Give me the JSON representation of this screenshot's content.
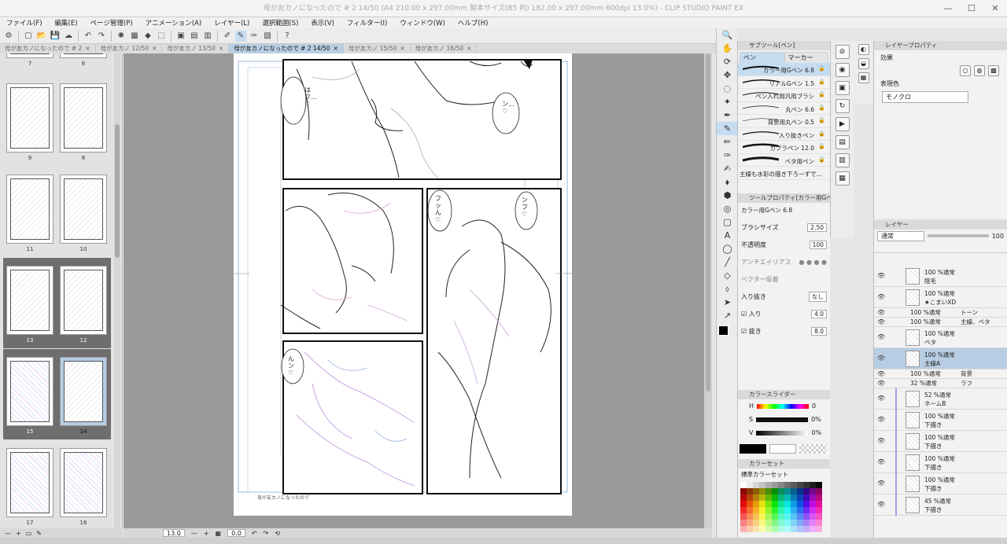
{
  "window": {
    "title": "母が友カノになったので # 2 14/50 (A4 210.00 x 297.00mm 製本サイズ(B5 判) 182.00 x 297.00mm 600dpi 13.0%) - CLIP STUDIO PAINT EX",
    "controls": [
      "—",
      "☐",
      "✕"
    ]
  },
  "menu": [
    "ファイル(F)",
    "編集(E)",
    "ページ管理(P)",
    "アニメーション(A)",
    "レイヤー(L)",
    "選択範囲(S)",
    "表示(V)",
    "フィルター(I)",
    "ウィンドウ(W)",
    "ヘルプ(H)"
  ],
  "toolbar": {
    "icons": [
      "⚙",
      "▢",
      "📂",
      "💾",
      "☁",
      "↶",
      "↷",
      "✺",
      "▦",
      "◆",
      "⬚",
      "▣",
      "▤",
      "▥",
      "✐",
      "✎",
      "✑",
      "▧",
      "?"
    ]
  },
  "doc_tabs": [
    {
      "label": "母が友カノになったので # 2",
      "close": "×",
      "active": false
    },
    {
      "label": "母が友カノ 12/50",
      "close": "×",
      "active": false
    },
    {
      "label": "母が友カノ 13/50",
      "close": "×",
      "active": false
    },
    {
      "label": "母が友カノになったので # 2 14/50",
      "close": "×",
      "active": true
    },
    {
      "label": "母が友カノ 15/50",
      "close": "×",
      "active": false
    },
    {
      "label": "母が友カノ 16/50",
      "close": "×",
      "active": false
    }
  ],
  "pages": {
    "spreads": [
      {
        "left": "7",
        "right": "6",
        "selected": false,
        "color": false
      },
      {
        "left": "9",
        "right": "8",
        "selected": false,
        "color": false
      },
      {
        "left": "11",
        "right": "10",
        "selected": false,
        "color": false
      },
      {
        "left": "13",
        "right": "12",
        "selected": true,
        "color": false
      },
      {
        "left": "15",
        "right": "14",
        "selected": true,
        "color": true,
        "highlight_right": true
      },
      {
        "left": "17",
        "right": "16",
        "selected": false,
        "color": true
      }
    ],
    "bottom": [
      "—",
      "+",
      "▭",
      "✎"
    ]
  },
  "canvas": {
    "speech": [
      "はフ…♡",
      "ン…♡",
      "フッん♡",
      "ンフ♡",
      "んン♡"
    ],
    "footer_text": "母が友カノになったので",
    "status": {
      "zoom": "13.0",
      "angle": "0.0",
      "buttons": [
        "—",
        "+",
        "▦",
        "↶",
        "↷",
        "⟲"
      ]
    }
  },
  "tools": [
    "🔍",
    "✋",
    "⟳",
    "✥",
    "◌",
    "✦",
    "✒",
    "✎",
    "✏",
    "✑",
    "✍",
    "⬧",
    "⬢",
    "◎",
    "▢",
    "A",
    "◯",
    "╱",
    "◇",
    "⬨",
    "➤",
    "↗"
  ],
  "subtool": {
    "title": "サブツール[ペン]",
    "tabs": [
      "ペン",
      "マーカー"
    ],
    "brushes": [
      {
        "name": "カラー用Gペン 6.8",
        "active": true
      },
      {
        "name": "リアルGペン 1.5",
        "active": false
      },
      {
        "name": "ペン入れ用汎用ブラシ",
        "active": false
      },
      {
        "name": "丸ペン 6.6",
        "active": false
      },
      {
        "name": "背景用丸ペン 0.5",
        "active": false
      },
      {
        "name": "入り抜きペン",
        "active": false
      },
      {
        "name": "カブラペン 12.0",
        "active": false
      },
      {
        "name": "ベタ用ペン",
        "active": false
      },
      {
        "name": "主線も水彩の描き下ろ一ずで…",
        "active": false
      }
    ],
    "lock_icon": "🔒"
  },
  "toolprop": {
    "title": "ツールプロパティ[カラー用Gペン 6.8]",
    "preset": "カラー用Gペン 6.8",
    "brush_size_label": "ブラシサイズ",
    "brush_size": "2.50",
    "opacity_label": "不透明度",
    "opacity": "100",
    "antialias_label": "アンチエイリアス",
    "vector_label": "ベクター吸着",
    "taper_label": "入り抜き",
    "taper_value": "なし",
    "in_label": "入り",
    "in_value": "4.0",
    "out_label": "抜き",
    "out_value": "8.0"
  },
  "colorslider": {
    "title": "カラースライダー",
    "h": "0",
    "s": "0%",
    "v": "0%",
    "main": "#000000",
    "sub": "#ffffff"
  },
  "colorset": {
    "title": "カラーセット",
    "selected": "標準カラーセット"
  },
  "layerprop": {
    "title": "レイヤープロパティ",
    "effect_label": "効果",
    "expression_label": "表現色",
    "expression_value": "モノクロ"
  },
  "layers": {
    "title": "レイヤー",
    "blend": "通常",
    "opacity": "100",
    "rows": [
      {
        "type": "layer",
        "line1": "100 %通常",
        "line2": "陰毛",
        "active": false
      },
      {
        "type": "layer",
        "line1": "100 %通常",
        "line2": "★こまいXD",
        "active": false
      },
      {
        "type": "folder",
        "line1": "100 %通常",
        "line2": "トーン",
        "active": false
      },
      {
        "type": "folder",
        "line1": "100 %通常",
        "line2": "主線、ベタ",
        "active": false
      },
      {
        "type": "layer",
        "line1": "100 %通常",
        "line2": "ベタ",
        "active": false
      },
      {
        "type": "layer",
        "line1": "100 %通常",
        "line2": "主線A",
        "active": true
      },
      {
        "type": "folder",
        "line1": "100 %通常",
        "line2": "背景",
        "active": false
      },
      {
        "type": "folder",
        "line1": "32 %通常",
        "line2": "ラフ",
        "active": false
      },
      {
        "type": "layer",
        "line1": "52 %通常",
        "line2": "ネームB",
        "active": false
      },
      {
        "type": "layer",
        "line1": "100 %通常",
        "line2": "下描き",
        "active": false
      },
      {
        "type": "layer",
        "line1": "100 %通常",
        "line2": "下描き",
        "active": false
      },
      {
        "type": "layer",
        "line1": "100 %通常",
        "line2": "下描き",
        "active": false
      },
      {
        "type": "layer",
        "line1": "100 %通常",
        "line2": "下描き",
        "active": false
      },
      {
        "type": "layer",
        "line1": "45 %通常",
        "line2": "下描き",
        "active": false
      }
    ]
  }
}
